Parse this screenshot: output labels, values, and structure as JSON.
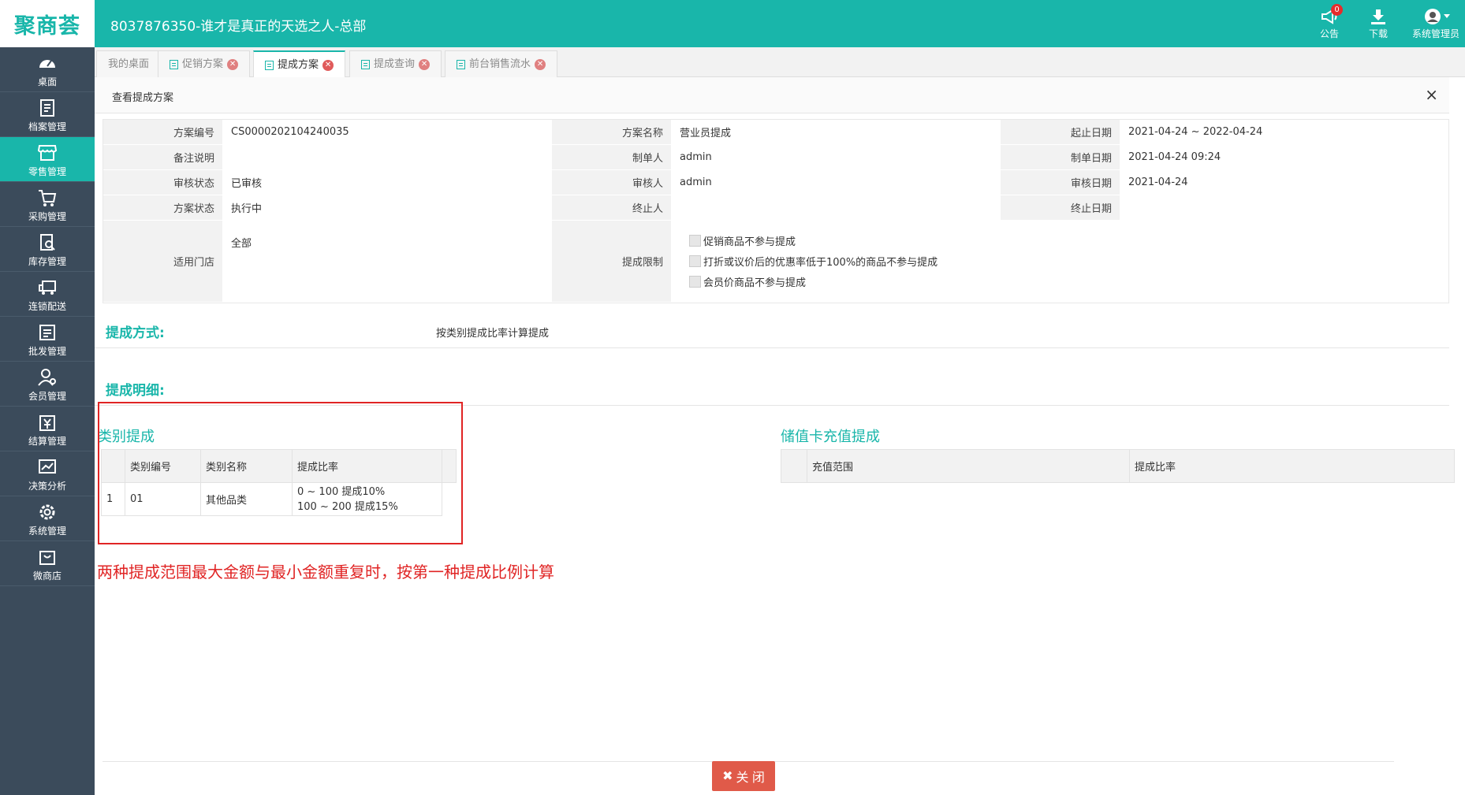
{
  "app": {
    "logo": "聚商荟",
    "shop_title": "8037876350-谁才是真正的天选之人-总部"
  },
  "topbar": {
    "notice_label": "公告",
    "notice_count": "0",
    "download_label": "下载",
    "user_label": "系统管理员"
  },
  "sidebar": {
    "items": [
      {
        "label": "桌面",
        "icon": "dashboard-icon"
      },
      {
        "label": "档案管理",
        "icon": "file-icon"
      },
      {
        "label": "零售管理",
        "icon": "store-icon",
        "active": true
      },
      {
        "label": "采购管理",
        "icon": "cart-icon"
      },
      {
        "label": "库存管理",
        "icon": "inventory-icon"
      },
      {
        "label": "连锁配送",
        "icon": "truck-icon"
      },
      {
        "label": "批发管理",
        "icon": "wholesale-icon"
      },
      {
        "label": "会员管理",
        "icon": "member-icon"
      },
      {
        "label": "结算管理",
        "icon": "settlement-icon"
      },
      {
        "label": "决策分析",
        "icon": "chart-icon"
      },
      {
        "label": "系统管理",
        "icon": "gear-icon"
      },
      {
        "label": "微商店",
        "icon": "shop-bag-icon"
      }
    ]
  },
  "tabs": [
    {
      "label": "我的桌面"
    },
    {
      "label": "促销方案"
    },
    {
      "label": "提成方案",
      "active": true
    },
    {
      "label": "提成查询"
    },
    {
      "label": "前台销售流水"
    }
  ],
  "panel": {
    "title": "查看提成方案",
    "close": "×"
  },
  "info": {
    "code_label": "方案编号",
    "code": "CS0000202104240035",
    "name_label": "方案名称",
    "name": "营业员提成",
    "period_label": "起止日期",
    "period": "2021-04-24 ~ 2022-04-24",
    "remark_label": "备注说明",
    "remark": "",
    "maker_label": "制单人",
    "maker": "admin",
    "make_date_label": "制单日期",
    "make_date": "2021-04-24 09:24",
    "audit_status_label": "审核状态",
    "audit_status": "已审核",
    "auditor_label": "审核人",
    "auditor": "admin",
    "audit_date_label": "审核日期",
    "audit_date": "2021-04-24",
    "plan_status_label": "方案状态",
    "plan_status": "执行中",
    "terminator_label": "终止人",
    "terminator": "",
    "end_date_label": "终止日期",
    "end_date": "",
    "stores_label": "适用门店",
    "stores": "全部",
    "limit_label": "提成限制",
    "limits": [
      "促销商品不参与提成",
      "打折或议价后的优惠率低于100%的商品不参与提成",
      "会员价商品不参与提成"
    ]
  },
  "method": {
    "title": "提成方式:",
    "value": "按类别提成比率计算提成"
  },
  "detail": {
    "title": "提成明细:"
  },
  "category": {
    "title": "类别提成",
    "headers": [
      "类别编号",
      "类别名称",
      "提成比率"
    ],
    "rows": [
      {
        "index": "1",
        "code": "01",
        "name": "其他品类",
        "rate_line1": "0 ~ 100 提成10%",
        "rate_line2": "100 ~ 200 提成15%"
      }
    ]
  },
  "card": {
    "title": "储值卡充值提成",
    "headers": [
      "充值范围",
      "提成比率"
    ]
  },
  "annotation": "两种提成范围最大金额与最小金额重复时，按第一种提成比例计算",
  "footer": {
    "close_label": "关 闭"
  },
  "colors": {
    "accent": "#19b6aa",
    "sidebar": "#3b4b5b",
    "annotation": "#e02424",
    "close_button": "#e05a49"
  }
}
